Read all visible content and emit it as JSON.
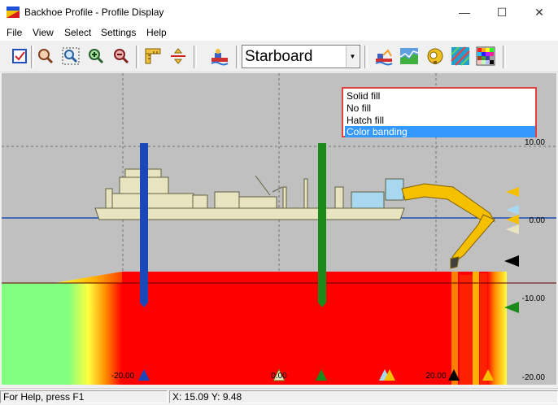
{
  "window": {
    "title": "Backhoe Profile - Profile Display",
    "minimize_glyph": "—",
    "maximize_glyph": "☐",
    "close_glyph": "✕"
  },
  "menu": [
    "File",
    "View",
    "Select",
    "Settings",
    "Help"
  ],
  "toolbar": {
    "view_select": "Starboard",
    "icons": [
      "checklist-icon",
      "zoom-icon",
      "zoom-window-icon",
      "zoom-in-icon",
      "zoom-out-icon",
      "ruler-icon",
      "measure-icon",
      "dredge-icon",
      "excavator-icon",
      "chart-icon",
      "helmet-icon",
      "hatch-icon",
      "color-palette-icon"
    ]
  },
  "fill_menu": {
    "options": [
      "Solid fill",
      "No fill",
      "Hatch fill",
      "Color banding"
    ],
    "selected": "Color banding"
  },
  "axis": {
    "y_labels": [
      "10.00",
      "0.00",
      "-10.00",
      "-20.00"
    ],
    "x_labels": [
      "-20.00",
      "0.00",
      "20.00"
    ]
  },
  "status": {
    "help": "For Help, press F1",
    "coords": "X: 15.09 Y: 9.48"
  },
  "colors": {
    "sediment": "#ff0000",
    "sky": "#c0c0c0",
    "water_line": "#1e4fb0",
    "barge": "#e8e4c0",
    "arm": "#f5c000",
    "left_spud": "#1a48b8",
    "right_spud": "#1a8a1a",
    "highlight": "#3399ff"
  }
}
